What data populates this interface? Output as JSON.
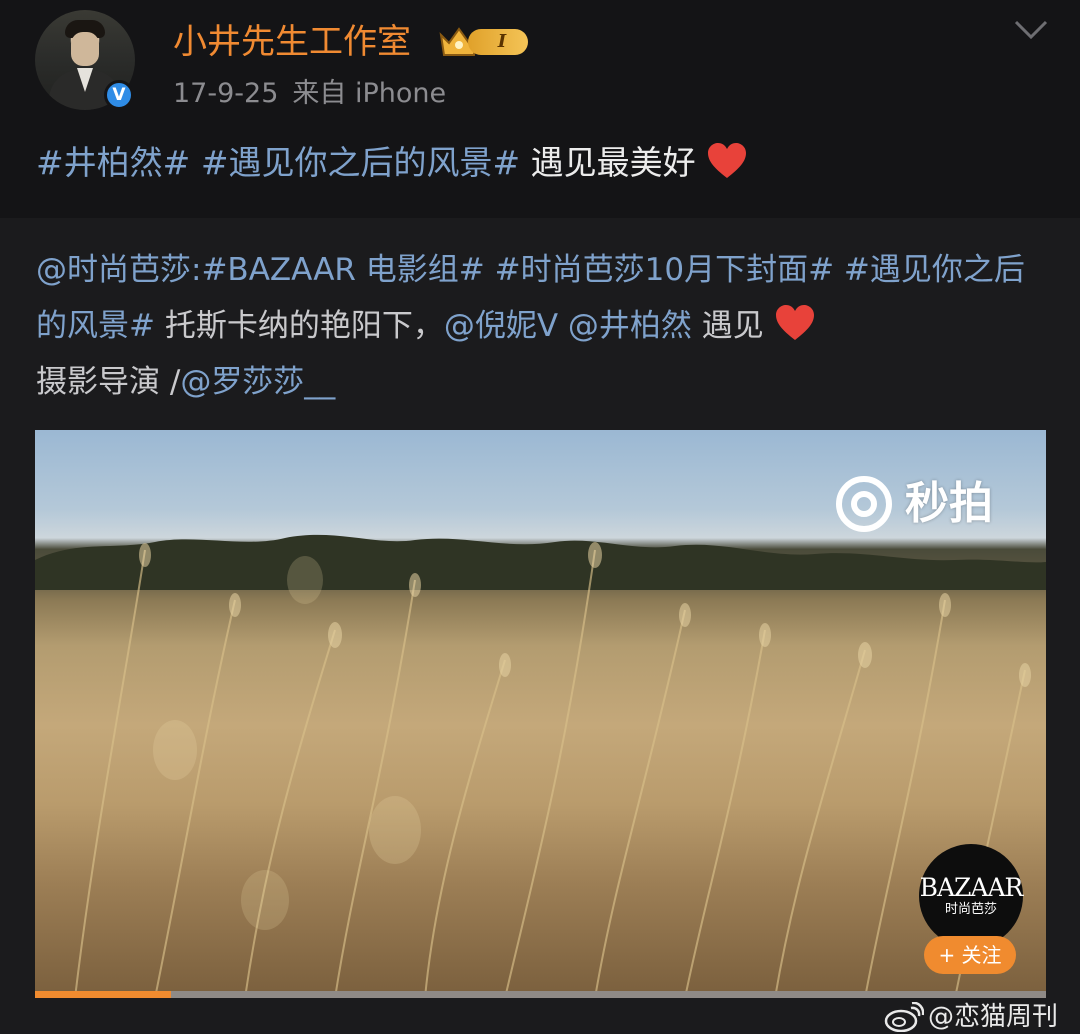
{
  "post": {
    "username": "小井先生工作室",
    "vip_level": "I",
    "verified_mark": "V",
    "date": "17-9-25",
    "source": "来自 iPhone",
    "text": {
      "topic1": "#井柏然#",
      "topic2": "#遇见你之后的风景#",
      "plain": "遇见最美好",
      "emoji": "heart-icon"
    }
  },
  "repost": {
    "author_mention": "@时尚芭莎",
    "colon": ":",
    "topic_a": "#BAZAAR 电影组#",
    "topic_b": "#时尚芭莎10月下封面#",
    "topic_c": "#遇见你之后的风景#",
    "text1": "托斯卡纳的艳阳下，",
    "mention1": "@倪妮Ⅴ",
    "mention2": "@井柏然",
    "text2": "遇见",
    "text3": "摄影导演 /",
    "mention3": "@罗莎莎__"
  },
  "video": {
    "platform_label": "秒拍",
    "channel_logo_word": "BAZAAR",
    "channel_logo_sub": "时尚芭莎",
    "follow_label": "+ 关注",
    "progress": 0.135
  },
  "watermark": {
    "text": "@恋猫周刊"
  },
  "colors": {
    "username": "#f08a32",
    "topic": "#7fa2cc",
    "accent": "#f08b2f",
    "heart": "#e8423a"
  }
}
